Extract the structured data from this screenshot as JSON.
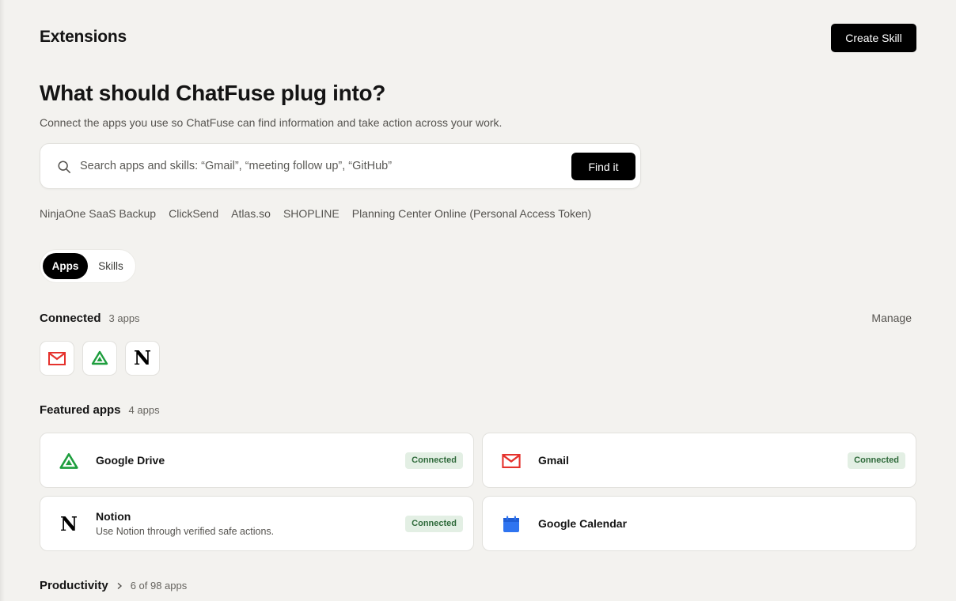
{
  "header": {
    "title": "Extensions",
    "create_label": "Create Skill"
  },
  "hero": {
    "title": "What should ChatFuse plug into?",
    "subtitle": "Connect the apps you use so ChatFuse can find information and take action across your work."
  },
  "search": {
    "placeholder": "Search apps and skills: “Gmail”, “meeting follow up”, “GitHub”",
    "value": "",
    "button_label": "Find it"
  },
  "suggestions": [
    "NinjaOne SaaS Backup",
    "ClickSend",
    "Atlas.so",
    "SHOPLINE",
    "Planning Center Online (Personal Access Token)"
  ],
  "tabs": {
    "apps": "Apps",
    "skills": "Skills",
    "active": "Apps"
  },
  "connected": {
    "title": "Connected",
    "count": "3 apps",
    "manage_label": "Manage",
    "icons": [
      "gmail-icon",
      "google-drive-icon",
      "notion-icon"
    ]
  },
  "featured": {
    "title": "Featured apps",
    "count": "4 apps",
    "items": [
      {
        "name": "Google Drive",
        "description": "",
        "status": "Connected",
        "icon": "google-drive-icon"
      },
      {
        "name": "Gmail",
        "description": "",
        "status": "Connected",
        "icon": "gmail-icon"
      },
      {
        "name": "Notion",
        "description": "Use Notion through verified safe actions.",
        "status": "Connected",
        "icon": "notion-icon"
      },
      {
        "name": "Google Calendar",
        "description": "",
        "status": "",
        "icon": "google-calendar-icon"
      }
    ]
  },
  "category": {
    "title": "Productivity",
    "count": "6 of 98 apps"
  },
  "colors": {
    "background": "#f3f2ef",
    "primary_button": "#000000",
    "badge_bg": "#e3efe4",
    "badge_text": "#2f6a3b",
    "gmail_red": "#e5322d",
    "drive_green": "#1e9e3e",
    "calendar_blue": "#2f74f0"
  }
}
